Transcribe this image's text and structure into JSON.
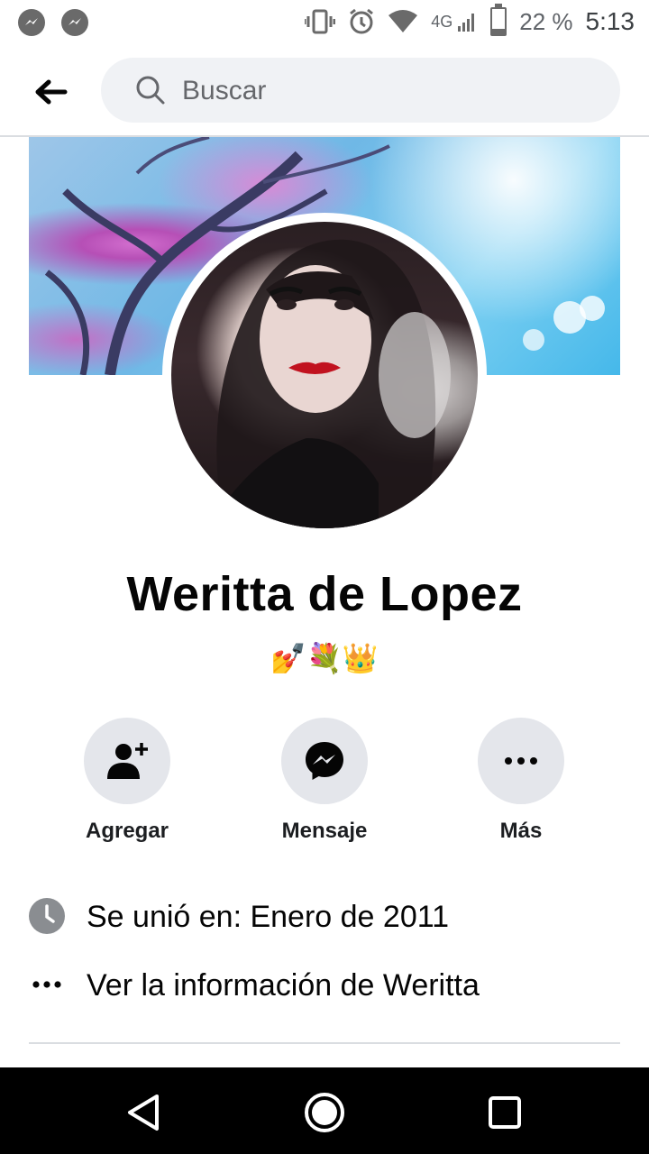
{
  "status_bar": {
    "network": "4G",
    "battery_text": "22 %",
    "battery_level": 0.22,
    "time": "5:13",
    "left_icons": [
      "messenger-notification-icon",
      "messenger-notification-icon"
    ],
    "right_icons": [
      "vibrate-icon",
      "alarm-icon",
      "wifi-icon",
      "signal-icon",
      "battery-icon"
    ]
  },
  "header": {
    "back_icon": "arrow-left-icon",
    "search_placeholder": "Buscar"
  },
  "profile": {
    "name": "Weritta de Lopez",
    "bio": "💅💐👑"
  },
  "actions": [
    {
      "label": "Agregar",
      "icon": "add-friend-icon"
    },
    {
      "label": "Mensaje",
      "icon": "messenger-icon"
    },
    {
      "label": "Más",
      "icon": "more-icon"
    }
  ],
  "info": [
    {
      "icon": "clock-icon",
      "text": "Se unió en: Enero de 2011"
    },
    {
      "icon": "ellipsis-icon",
      "text": "Ver la información de Weritta"
    }
  ],
  "nav_bar": {
    "buttons": [
      "back-triangle-icon",
      "home-circle-icon",
      "recents-square-icon"
    ]
  },
  "colors": {
    "accent_bg": "#e4e6eb",
    "search_bg": "#f0f2f5",
    "text_primary": "#050505"
  }
}
